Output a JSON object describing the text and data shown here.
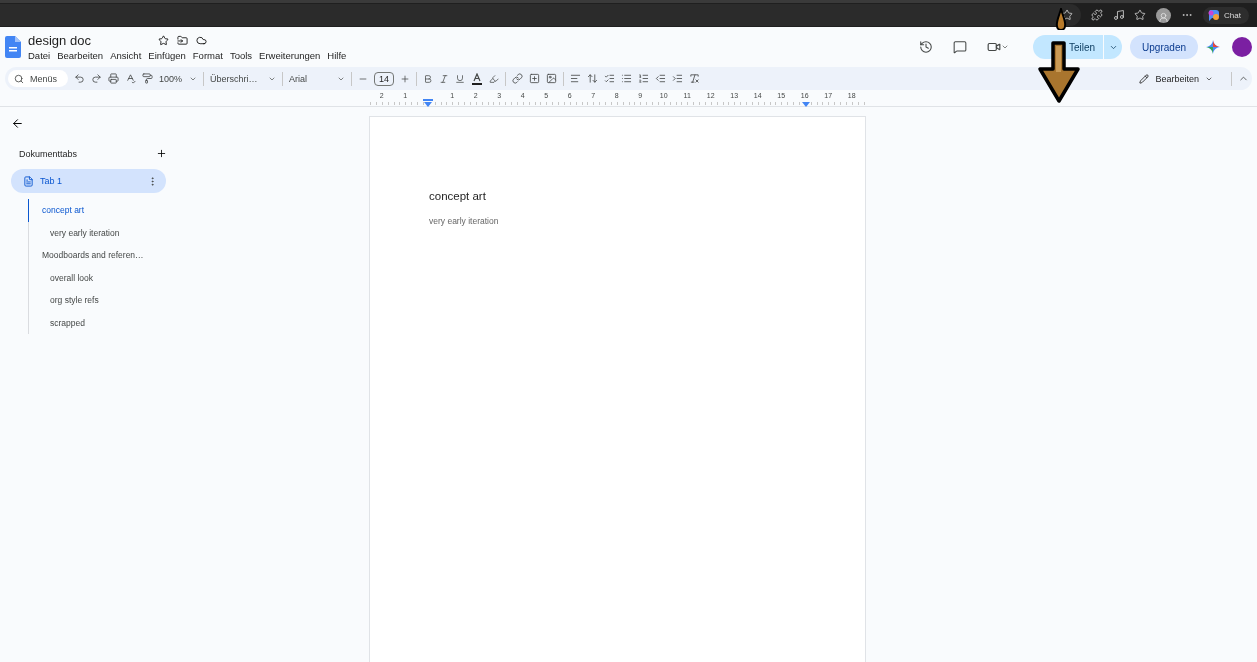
{
  "browser_bar": {
    "chat_label": "Chat"
  },
  "document": {
    "title": "design doc",
    "menu": [
      "Datei",
      "Bearbeiten",
      "Ansicht",
      "Einfügen",
      "Format",
      "Tools",
      "Erweiterungen",
      "Hilfe"
    ]
  },
  "header_actions": {
    "share": "Teilen",
    "upgrade": "Upgraden"
  },
  "toolbar": {
    "search_placeholder": "Menüs",
    "zoom": "100%",
    "style": "Überschri…",
    "font": "Arial",
    "font_size": "14",
    "mode": "Bearbeiten"
  },
  "ruler": {
    "labels": [
      "2",
      "1",
      "1",
      "2",
      "3",
      "4",
      "5",
      "6",
      "7",
      "8",
      "9",
      "10",
      "11",
      "12",
      "13",
      "14",
      "15",
      "16",
      "17",
      "18"
    ]
  },
  "sidebar": {
    "heading": "Dokumenttabs",
    "tabs": [
      {
        "label": "Tab 1",
        "selected": true
      }
    ],
    "outline": [
      {
        "label": "concept art",
        "selected": true,
        "children": [
          {
            "label": "very early iteration",
            "selected": false
          }
        ]
      },
      {
        "label": "Moodboards and referen…",
        "selected": false,
        "children": [
          {
            "label": "overall look",
            "selected": false
          },
          {
            "label": "org style refs",
            "selected": false
          },
          {
            "label": "scrapped",
            "selected": false
          }
        ]
      }
    ]
  },
  "page": {
    "paragraphs": [
      {
        "kind": "heading",
        "text": "concept art"
      },
      {
        "kind": "subheading",
        "text": "very early iteration"
      }
    ]
  }
}
